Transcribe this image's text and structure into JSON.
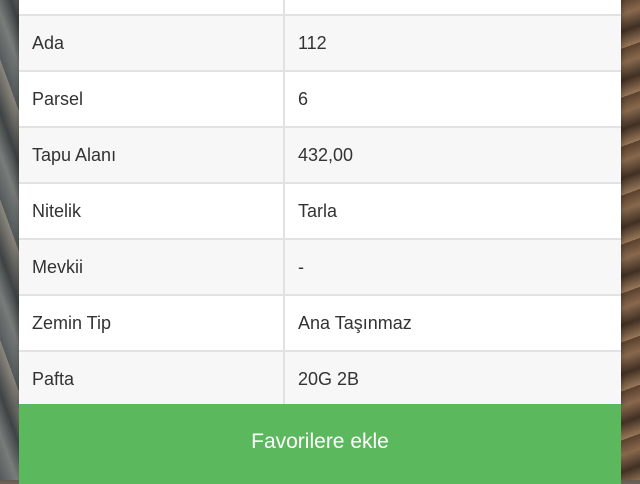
{
  "parcel_details": {
    "rows": [
      {
        "label": "",
        "value": ""
      },
      {
        "label": "Ada",
        "value": "112"
      },
      {
        "label": "Parsel",
        "value": "6"
      },
      {
        "label": "Tapu Alanı",
        "value": "432,00"
      },
      {
        "label": "Nitelik",
        "value": "Tarla"
      },
      {
        "label": "Mevkii",
        "value": "-"
      },
      {
        "label": "Zemin Tip",
        "value": "Ana Taşınmaz"
      },
      {
        "label": "Pafta",
        "value": "20G 2B"
      }
    ]
  },
  "actions": {
    "favorite_label": "Favorilere ekle"
  },
  "colors": {
    "button_green": "#5cb85c",
    "row_border": "#e2e2e2",
    "text": "#333333"
  }
}
